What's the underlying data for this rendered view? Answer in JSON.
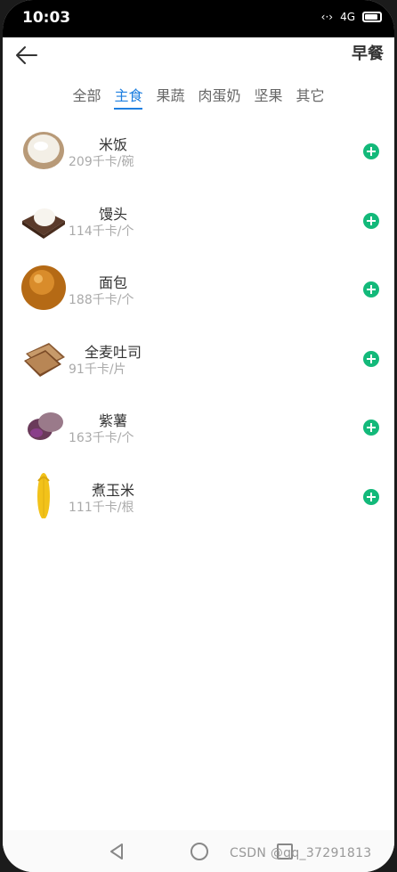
{
  "status_bar": {
    "time": "10:03",
    "network_label": "4G"
  },
  "header": {
    "title": "早餐"
  },
  "tabs": [
    {
      "label": "全部",
      "active": false
    },
    {
      "label": "主食",
      "active": true
    },
    {
      "label": "果蔬",
      "active": false
    },
    {
      "label": "肉蛋奶",
      "active": false
    },
    {
      "label": "坚果",
      "active": false
    },
    {
      "label": "其它",
      "active": false
    }
  ],
  "foods": [
    {
      "name": "米饭",
      "calories": "209千卡/碗",
      "icon": "rice-bowl-icon"
    },
    {
      "name": "馒头",
      "calories": "114千卡/个",
      "icon": "steamed-bun-icon"
    },
    {
      "name": "面包",
      "calories": "188千卡/个",
      "icon": "bread-icon"
    },
    {
      "name": "全麦吐司",
      "calories": "91千卡/片",
      "icon": "toast-icon"
    },
    {
      "name": "紫薯",
      "calories": "163千卡/个",
      "icon": "sweet-potato-icon"
    },
    {
      "name": "煮玉米",
      "calories": "111千卡/根",
      "icon": "corn-icon"
    }
  ],
  "watermark": "CSDN @qq_37291813",
  "colors": {
    "accent": "#1e7fe0",
    "add": "#13b97a"
  }
}
